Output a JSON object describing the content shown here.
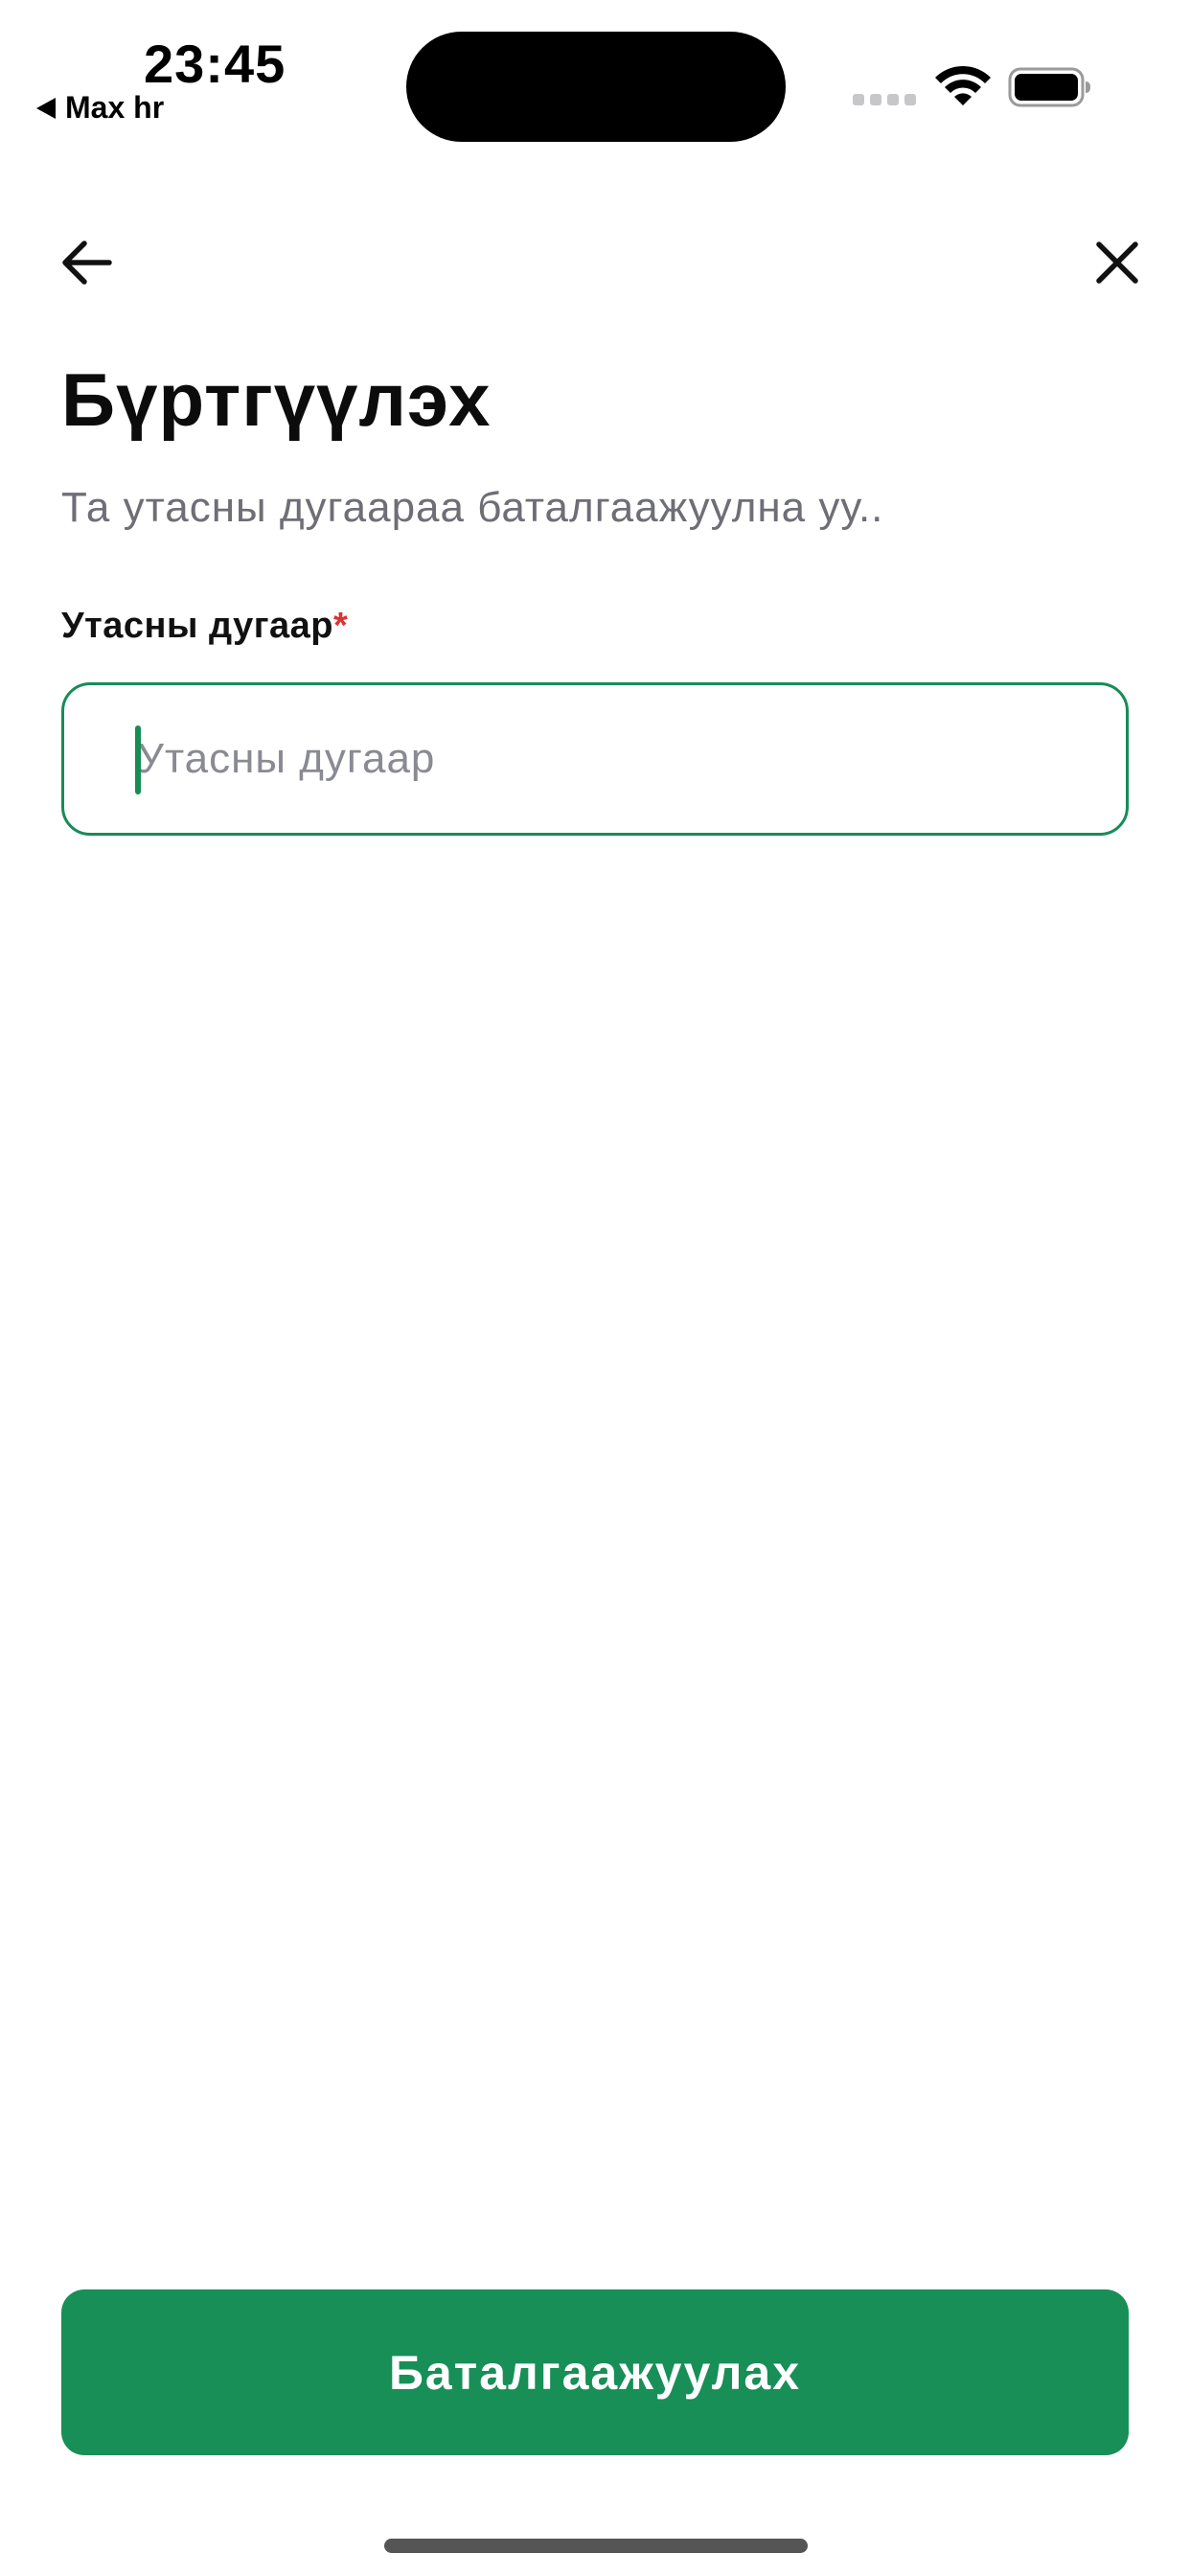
{
  "status_bar": {
    "time": "23:45",
    "back_app": "Max hr",
    "icons": [
      "signal-icon",
      "wifi-icon",
      "battery-icon"
    ]
  },
  "nav": {
    "back_icon": "arrow-left-icon",
    "close_icon": "close-icon"
  },
  "title": "Бүртгүүлэх",
  "subtitle": "Та утасны дугаараа баталгаажуулна уу..",
  "phone": {
    "label": "Утасны дугаар",
    "required_mark": "*",
    "value": "",
    "placeholder": "Утасны дугаар"
  },
  "confirm_button": {
    "label": "Баталгаажуулах"
  },
  "colors": {
    "accent": "#178f57",
    "required": "#e03030",
    "subtitle": "#6e6e76"
  }
}
